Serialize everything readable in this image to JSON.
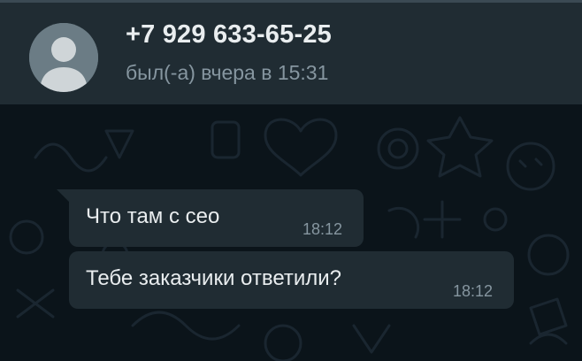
{
  "header": {
    "contact_name": "+7 929 633-65-25",
    "last_seen": "был(-а) вчера в 15:31",
    "avatar_icon": "default-user-avatar"
  },
  "messages": [
    {
      "text": "Что там с сео",
      "time": "18:12",
      "direction": "incoming"
    },
    {
      "text": "Тебе заказчики ответили?",
      "time": "18:12",
      "direction": "incoming"
    }
  ],
  "colors": {
    "background": "#0b141a",
    "header": "#202c33",
    "bubble_incoming": "#202c33",
    "text_primary": "#e9edef",
    "text_secondary": "#8696a0"
  }
}
